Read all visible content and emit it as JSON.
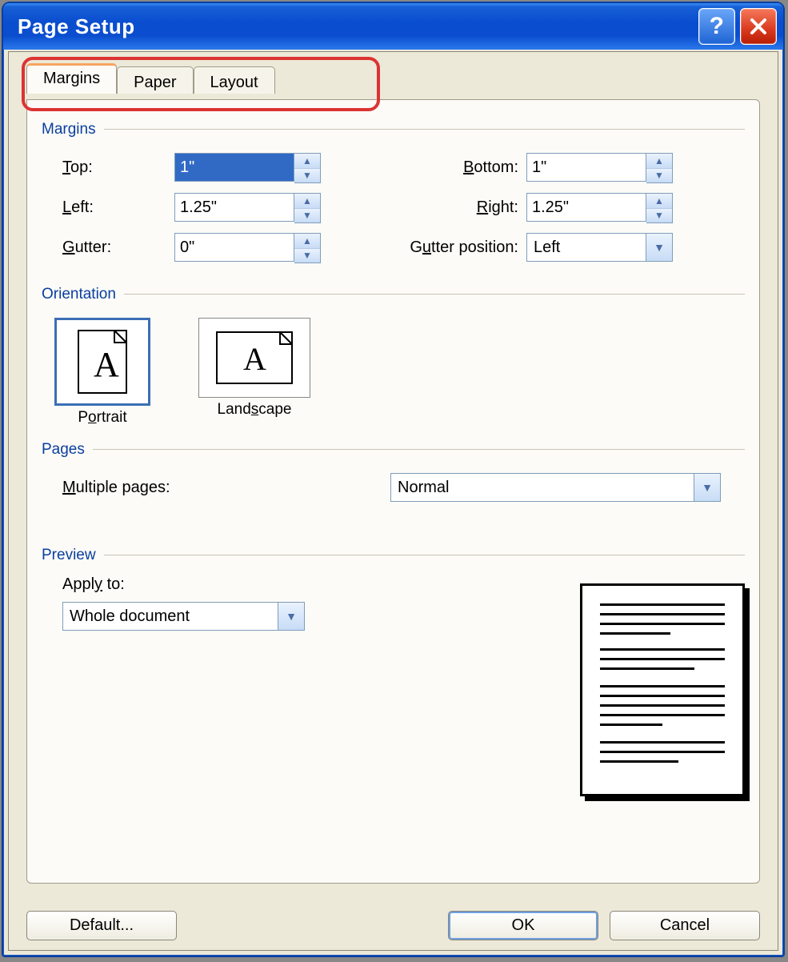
{
  "title": "Page Setup",
  "tabs": {
    "margins": "Margins",
    "paper": "Paper",
    "layout": "Layout"
  },
  "margins": {
    "legend": "Margins",
    "top_label": "Top:",
    "top_value": "1\"",
    "bottom_label": "Bottom:",
    "bottom_value": "1\"",
    "left_label": "Left:",
    "left_value": "1.25\"",
    "right_label": "Right:",
    "right_value": "1.25\"",
    "gutter_label": "Gutter:",
    "gutter_value": "0\"",
    "gutter_pos_label": "Gutter position:",
    "gutter_pos_value": "Left"
  },
  "orientation": {
    "legend": "Orientation",
    "portrait": "Portrait",
    "landscape": "Landscape"
  },
  "pages": {
    "legend": "Pages",
    "multiple_label": "Multiple pages:",
    "multiple_value": "Normal"
  },
  "preview": {
    "legend": "Preview",
    "apply_label": "Apply to:",
    "apply_value": "Whole document"
  },
  "buttons": {
    "default": "Default...",
    "ok": "OK",
    "cancel": "Cancel"
  }
}
